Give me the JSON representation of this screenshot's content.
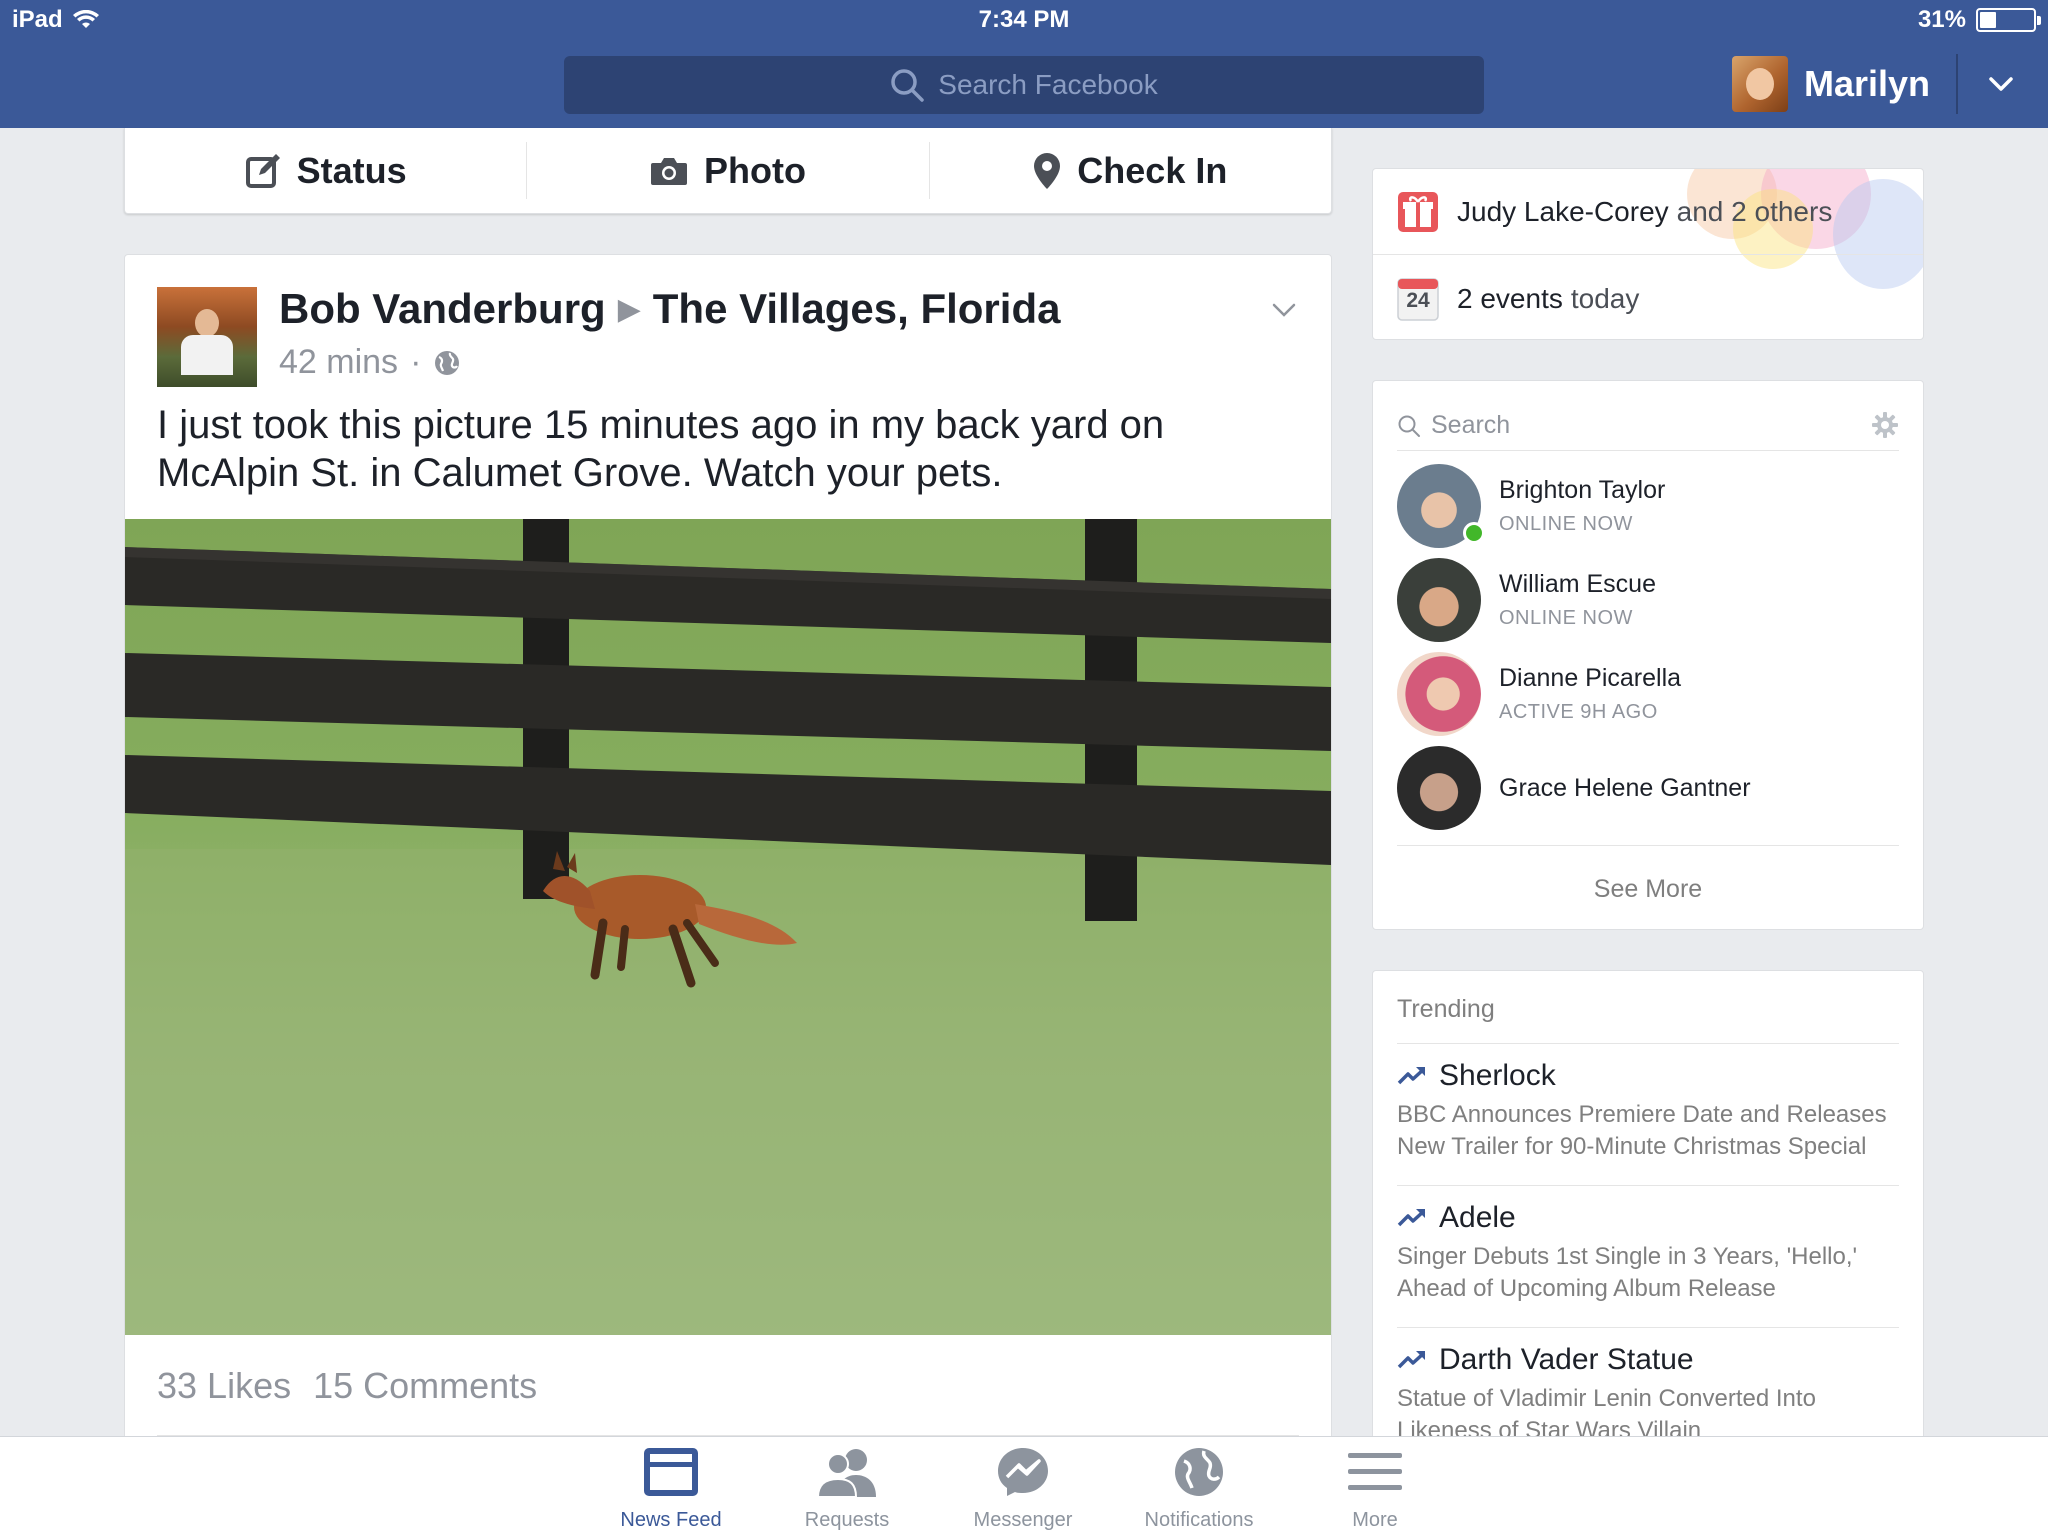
{
  "status_bar": {
    "device": "iPad",
    "time": "7:34 PM",
    "battery_percent": "31%",
    "battery_level": 0.31
  },
  "header": {
    "search_placeholder": "Search Facebook",
    "user_name": "Marilyn"
  },
  "composer": {
    "status_label": "Status",
    "photo_label": "Photo",
    "checkin_label": "Check In"
  },
  "post": {
    "author": "Bob Vanderburg",
    "location": "The Villages, Florida",
    "time": "42 mins",
    "separator": "·",
    "text": "I just took this picture 15 minutes ago in my back yard on McAlpin St. in Calumet Grove. Watch your pets.",
    "likes": "33 Likes",
    "comments": "15 Comments"
  },
  "reminders": {
    "birthday_name": "Judy Lake-Corey",
    "birthday_rest": "and 2 others",
    "calendar_day": "24",
    "events_count": "2 events",
    "events_rest": "today"
  },
  "chat": {
    "search_placeholder": "Search",
    "friends": [
      {
        "name": "Brighton Taylor",
        "status": "ONLINE NOW"
      },
      {
        "name": "William Escue",
        "status": "ONLINE NOW"
      },
      {
        "name": "Dianne Picarella",
        "status": "ACTIVE 9H AGO"
      },
      {
        "name": "Grace Helene Gantner",
        "status": ""
      }
    ],
    "see_more": "See More"
  },
  "trending": {
    "title": "Trending",
    "items": [
      {
        "topic": "Sherlock",
        "desc": "BBC Announces Premiere Date and Releases New Trailer for 90-Minute Christmas Special"
      },
      {
        "topic": "Adele",
        "desc": "Singer Debuts 1st Single in 3 Years, 'Hello,' Ahead of Upcoming Album Release"
      },
      {
        "topic": "Darth Vader Statue",
        "desc": "Statue of Vladimir Lenin Converted Into Likeness of Star Wars Villain"
      }
    ]
  },
  "tabs": [
    {
      "label": "News Feed",
      "icon": "news-feed-icon"
    },
    {
      "label": "Requests",
      "icon": "requests-icon"
    },
    {
      "label": "Messenger",
      "icon": "messenger-icon"
    },
    {
      "label": "Notifications",
      "icon": "globe-icon"
    },
    {
      "label": "More",
      "icon": "menu-icon"
    }
  ],
  "colors": {
    "brand": "#3b5998",
    "online": "#42b72a",
    "muted": "#90949c"
  }
}
